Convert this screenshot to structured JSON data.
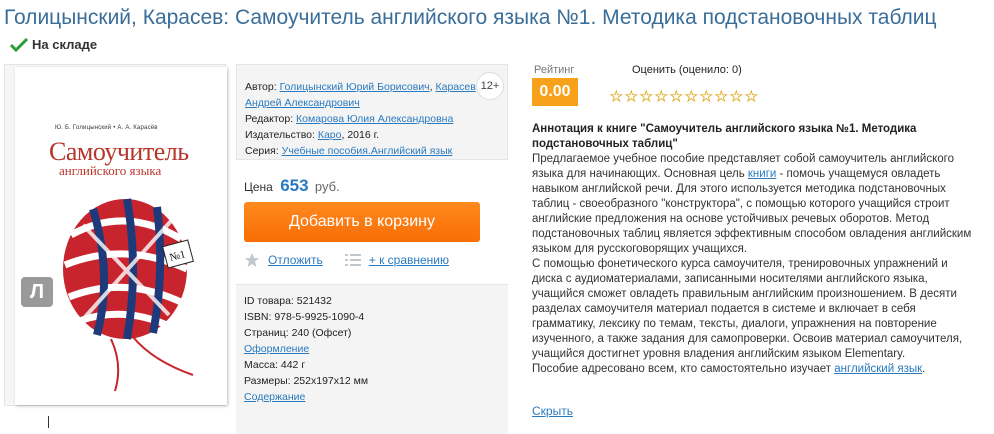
{
  "title": "Голицынский, Карасев: Самоучитель английского языка №1. Методика подстановочных таблиц",
  "stock": "На складе",
  "cover": {
    "authors": "Ю. Б. Голицынский • А. А. Карасёв",
    "big": "Самоучитель",
    "sub": "английского языка",
    "badge": "Л"
  },
  "info": {
    "author_label": "Автор:",
    "author_1": "Голицынский Юрий Борисович",
    "author_2": "Карасев",
    "author_2_cont": "Андрей Александрович",
    "editor_label": "Редактор:",
    "editor": "Комарова Юлия Александровна",
    "publisher_label": "Издательство:",
    "publisher": "Каро",
    "year": ", 2016 г.",
    "series_label": "Серия:",
    "series": "Учебные пособия.Английский язык",
    "age": "12+"
  },
  "price": {
    "label": "Цена",
    "value": "653",
    "currency": "руб."
  },
  "buttons": {
    "add_to_cart": "Добавить в корзину",
    "defer": "Отложить",
    "compare": "+ к сравнению"
  },
  "details": {
    "id": "ID товара: 521432",
    "isbn": "ISBN: 978-5-9925-1090-4",
    "pages": "Страниц: 240 (Офсет)",
    "design_link": "Оформление",
    "weight": "Масса: 442 г",
    "size": "Размеры: 252x197x12 мм",
    "contents_link": "Содержание"
  },
  "rating": {
    "label": "Рейтинг",
    "value": "0.00",
    "rate_label": "Оценить (оценило: 0)",
    "stars_total": 10
  },
  "annotation": {
    "title": "Аннотация к книге \"Самоучитель английского языка №1. Методика подстановочных таблиц\"",
    "p1_a": "Предлагаемое учебное пособие представляет собой самоучитель английского языка для начинающих. Основная цель ",
    "p1_link": "книги",
    "p1_b": " - помочь учащемуся овладеть навыком английской речи. Для этого используется методика подстановочных таблиц - своеобразного \"конструктора\", с помощью которого учащийся строит английские предложения на основе устойчивых речевых оборотов. Метод подстановочных таблиц является эффективным способом овладения английским языком для русскоговорящих учащихся.",
    "p2": "С помощью фонетического курса самоучителя, тренировочных упражнений и диска с аудиоматериалами, записанными носителями английского языка, учащийся сможет овладеть правильным английским произношением. В десяти разделах самоучителя материал подается в системе и включает в себя грамматику, лексику по темам, тексты, диалоги, упражнения на повторение изученного, а также задания для самопроверки. Освоив материал самоучителя, учащийся достигнет уровня владения английским языком Elementary.",
    "p3_a": "Пособие адресовано всем, кто самостоятельно изучает ",
    "p3_link": "английский язык",
    "p3_b": ".",
    "hide_link": "Скрыть"
  },
  "colors": {
    "accent": "#2a7abf",
    "orange": "#f86d06",
    "rating": "#f7a11a",
    "stock_check": "#2e9e3a"
  }
}
